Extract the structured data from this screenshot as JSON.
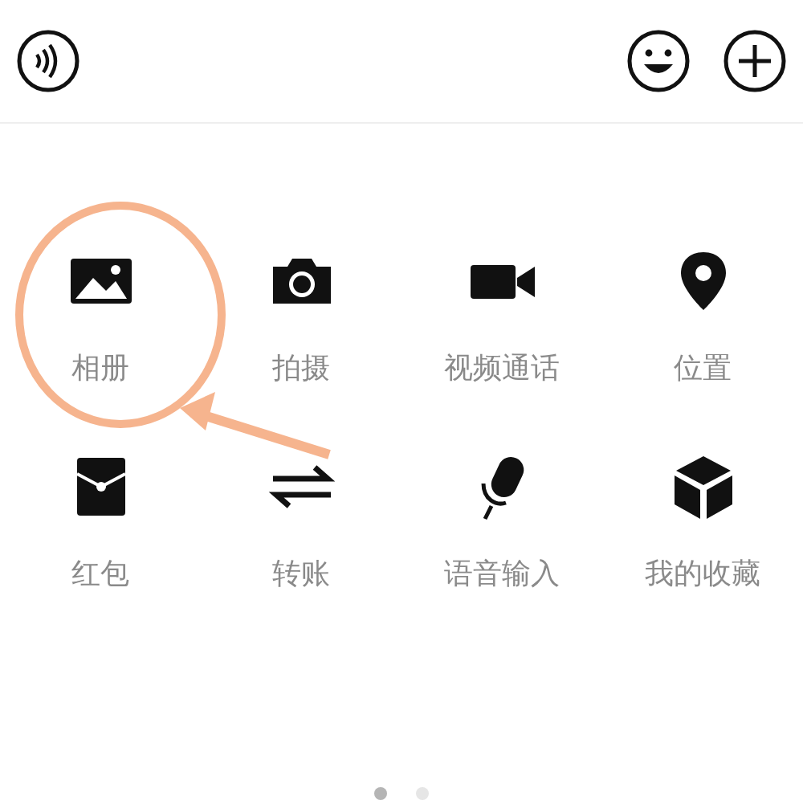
{
  "panel_items": [
    {
      "label": "相册",
      "kind": "photo"
    },
    {
      "label": "拍摄",
      "kind": "camera"
    },
    {
      "label": "视频通话",
      "kind": "video"
    },
    {
      "label": "位置",
      "kind": "location"
    },
    {
      "label": "红包",
      "kind": "envelope"
    },
    {
      "label": "转账",
      "kind": "transfer"
    },
    {
      "label": "语音输入",
      "kind": "mic"
    },
    {
      "label": "我的收藏",
      "kind": "cube"
    }
  ],
  "pages": [
    {
      "selected": true
    },
    {
      "selected": false
    }
  ]
}
